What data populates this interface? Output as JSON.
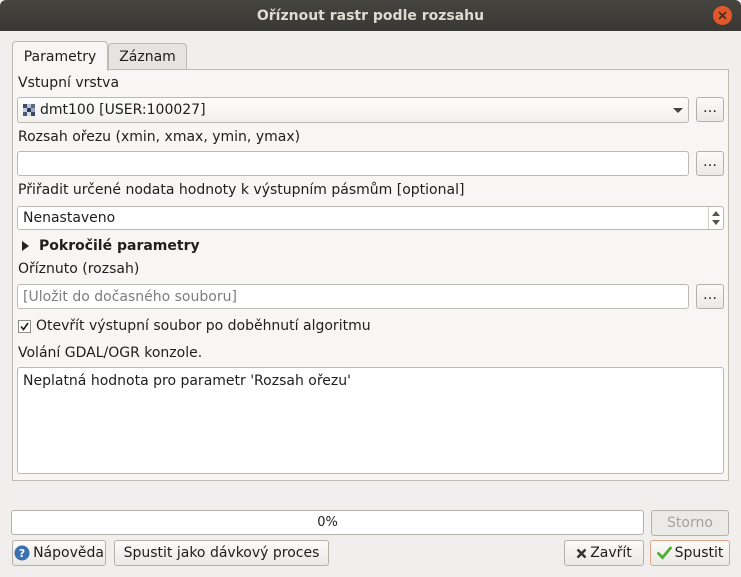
{
  "window": {
    "title": "Oříznout rastr podle rozsahu"
  },
  "tabs": [
    {
      "label": "Parametry",
      "active": true
    },
    {
      "label": "Záznam",
      "active": false
    }
  ],
  "params": {
    "input_layer_label": "Vstupní vrstva",
    "input_layer_value": "dmt100 [USER:100027]",
    "extent_label": "Rozsah ořezu (xmin, xmax, ymin, ymax)",
    "extent_value": "",
    "nodata_label": "Přiřadit určené nodata hodnoty k výstupním pásmům [optional]",
    "nodata_value": "Nenastaveno",
    "advanced_label": "Pokročilé parametry",
    "output_label": "Oříznuto (rozsah)",
    "output_placeholder": "[Uložit do dočasného souboru]",
    "open_output_label": "Otevřít výstupní soubor po doběhnutí algoritmu",
    "open_output_checked": true,
    "console_label": "Volání GDAL/OGR konzole.",
    "console_text": "Neplatná hodnota pro parametr 'Rozsah ořezu'",
    "browse_label": "…"
  },
  "progress": {
    "value": 0,
    "text": "0%"
  },
  "buttons": {
    "cancel": "Storno",
    "help": "Nápověda",
    "batch": "Spustit jako dávkový proces",
    "close": "Zavřít",
    "run": "Spustit"
  },
  "colors": {
    "titlebar": "#3c3b37",
    "close_button": "#e2582b",
    "help_icon": "#3a6fb0",
    "run_check": "#4caf2e",
    "close_x": "#333333"
  }
}
